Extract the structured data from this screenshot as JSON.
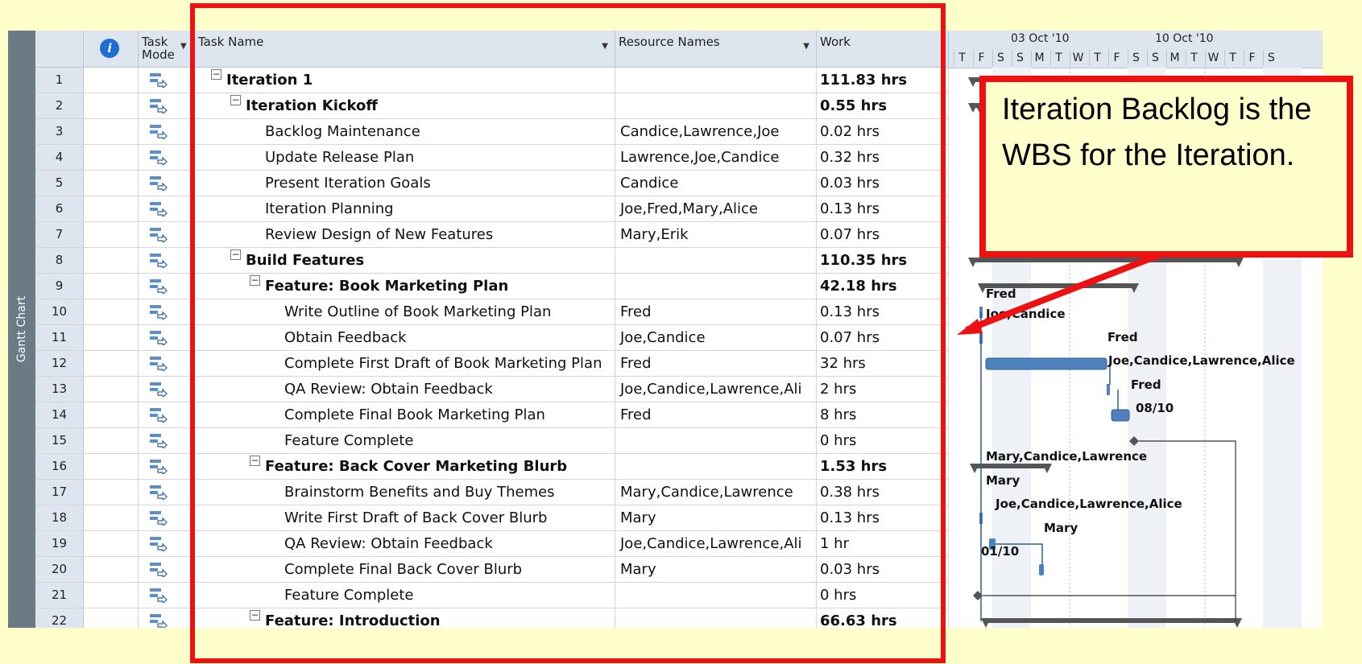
{
  "side_tab": "Gantt Chart",
  "columns": {
    "task_mode": "Task\nMode",
    "task_name": "Task Name",
    "resource_names": "Resource Names",
    "work": "Work"
  },
  "rows": [
    {
      "id": "1",
      "name": "Iteration 1",
      "res": "",
      "work": "111.83 hrs",
      "level": 0,
      "bold": true,
      "summary": true
    },
    {
      "id": "2",
      "name": "Iteration Kickoff",
      "res": "",
      "work": "0.55 hrs",
      "level": 1,
      "bold": true,
      "summary": true
    },
    {
      "id": "3",
      "name": "Backlog Maintenance",
      "res": "Candice,Lawrence,Joe",
      "work": "0.02 hrs",
      "level": 2
    },
    {
      "id": "4",
      "name": "Update Release Plan",
      "res": "Lawrence,Joe,Candice",
      "work": "0.32 hrs",
      "level": 2
    },
    {
      "id": "5",
      "name": "Present Iteration Goals",
      "res": "Candice",
      "work": "0.03 hrs",
      "level": 2
    },
    {
      "id": "6",
      "name": "Iteration Planning",
      "res": "Joe,Fred,Mary,Alice",
      "work": "0.13 hrs",
      "level": 2
    },
    {
      "id": "7",
      "name": "Review Design of New Features",
      "res": "Mary,Erik",
      "work": "0.07 hrs",
      "level": 2
    },
    {
      "id": "8",
      "name": "Build Features",
      "res": "",
      "work": "110.35 hrs",
      "level": 1,
      "bold": true,
      "summary": true
    },
    {
      "id": "9",
      "name": "Feature:  Book Marketing Plan",
      "res": "",
      "work": "42.18 hrs",
      "level": 2,
      "bold": true,
      "summary": true
    },
    {
      "id": "10",
      "name": "Write Outline of Book Marketing Plan",
      "res": "Fred",
      "work": "0.13 hrs",
      "level": 3
    },
    {
      "id": "11",
      "name": "Obtain Feedback",
      "res": "Joe,Candice",
      "work": "0.07 hrs",
      "level": 3
    },
    {
      "id": "12",
      "name": "Complete First Draft of Book Marketing Plan",
      "res": "Fred",
      "work": "32 hrs",
      "level": 3
    },
    {
      "id": "13",
      "name": "QA Review: Obtain Feedback",
      "res": "Joe,Candice,Lawrence,Ali",
      "work": "2 hrs",
      "level": 3
    },
    {
      "id": "14",
      "name": "Complete Final Book Marketing Plan",
      "res": "Fred",
      "work": "8 hrs",
      "level": 3
    },
    {
      "id": "15",
      "name": "Feature Complete",
      "res": "",
      "work": "0 hrs",
      "level": 3
    },
    {
      "id": "16",
      "name": "Feature:  Back Cover Marketing Blurb",
      "res": "",
      "work": "1.53 hrs",
      "level": 2,
      "bold": true,
      "summary": true
    },
    {
      "id": "17",
      "name": "Brainstorm Benefits and Buy Themes",
      "res": "Mary,Candice,Lawrence",
      "work": "0.38 hrs",
      "level": 3
    },
    {
      "id": "18",
      "name": "Write First Draft of Back Cover Blurb",
      "res": "Mary",
      "work": "0.13 hrs",
      "level": 3
    },
    {
      "id": "19",
      "name": "QA Review: Obtain Feedback",
      "res": "Joe,Candice,Lawrence,Ali",
      "work": "1 hr",
      "level": 3
    },
    {
      "id": "20",
      "name": "Complete Final Back Cover Blurb",
      "res": "Mary",
      "work": "0.03 hrs",
      "level": 3
    },
    {
      "id": "21",
      "name": "Feature Complete",
      "res": "",
      "work": "0 hrs",
      "level": 3
    },
    {
      "id": "22",
      "name": "Feature: Introduction",
      "res": "",
      "work": "66.63 hrs",
      "level": 2,
      "bold": true,
      "summary": true
    }
  ],
  "gantt": {
    "weeks": [
      "03 Oct '10",
      "10 Oct '10"
    ],
    "days": [
      "T",
      "F",
      "S",
      "S",
      "M",
      "T",
      "W",
      "T",
      "F",
      "S",
      "S",
      "M",
      "T",
      "W",
      "T",
      "F",
      "S"
    ],
    "labels": {
      "r10": "Fred",
      "r11": "Joe,Candice",
      "r12": "Fred",
      "r13": "Joe,Candice,Lawrence,Alice",
      "r14": "Fred",
      "r15": "08/10",
      "r17": "Mary,Candice,Lawrence",
      "r18": "Mary",
      "r19": "Joe,Candice,Lawrence,Alice",
      "r20": "Mary",
      "r21": "01/10"
    }
  },
  "callout": "Iteration Backlog is the WBS for the Iteration.",
  "colors": {
    "background": "#ffffcc",
    "highlight": "#ee1111",
    "bar": "#4f81bd",
    "summary": "#555555"
  }
}
